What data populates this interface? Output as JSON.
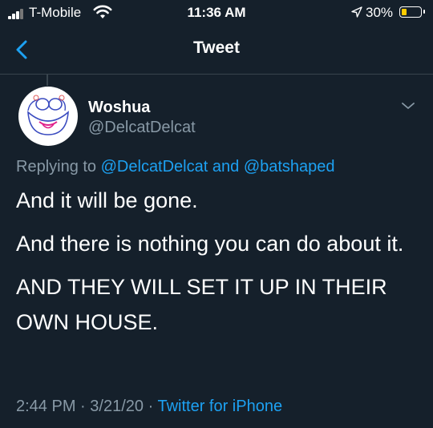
{
  "status_bar": {
    "carrier": "T-Mobile",
    "time": "11:36 AM",
    "battery_percent": "30%",
    "battery_level": 0.3,
    "battery_color": "#ffcc00"
  },
  "nav": {
    "title": "Tweet",
    "back_icon": "chevron-left-icon"
  },
  "tweet": {
    "author_name": "Woshua",
    "author_handle": "@DelcatDelcat",
    "replying_prefix": "Replying to",
    "replying_user_1": "@DelcatDelcat",
    "replying_and": "and",
    "replying_user_2": "@batshaped",
    "paragraphs": [
      "And it will be gone.",
      "And there is nothing you can do about it.",
      "AND THEY WILL SET IT UP IN THEIR OWN HOUSE."
    ],
    "time": "2:44 PM",
    "date": "3/21/20",
    "separator": "·",
    "source": "Twitter for iPhone"
  },
  "colors": {
    "background": "#15202b",
    "accent": "#1da1f2",
    "secondary_text": "#8899a6"
  }
}
